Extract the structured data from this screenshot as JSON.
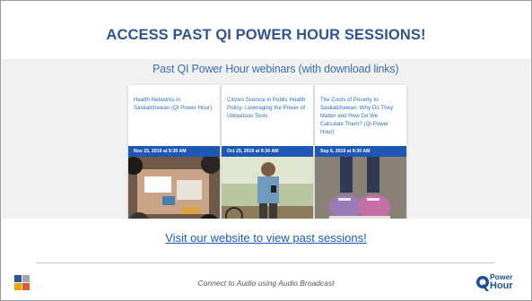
{
  "slide": {
    "title": "ACCESS PAST QI POWER HOUR SESSIONS!",
    "link_text": "Visit our website to view past sessions!",
    "footer_note": "Connect to Audio using Audio Broadcast"
  },
  "screenshot": {
    "heading": "Past QI Power Hour webinars (with download links)",
    "cards": [
      {
        "title": "Health Networks in Saskatchewan (QI Power Hour)",
        "date": "Nov 15, 2019 at 9:30 AM",
        "image": "group-meeting-photo"
      },
      {
        "title": "Citizen Science in Public Health Policy: Leveraging the Power of Ubiquitous Tools",
        "date": "Oct 25, 2019 at 9:30 AM",
        "image": "man-with-phone-photo"
      },
      {
        "title": "The Costs of Poverty to Saskatchewan: Why Do They Matter and How Do We Calculate Them? (QI Power Hour)",
        "date": "Sep 6, 2019 at 9:30 AM",
        "image": "sneakers-photo"
      }
    ]
  },
  "logo": {
    "line1": "Power",
    "line2": "Hour"
  },
  "colors": {
    "title": "#2f5496",
    "link": "#1f57c4",
    "date_bar": "#1f57b5",
    "card_title": "#2f6fc4"
  }
}
